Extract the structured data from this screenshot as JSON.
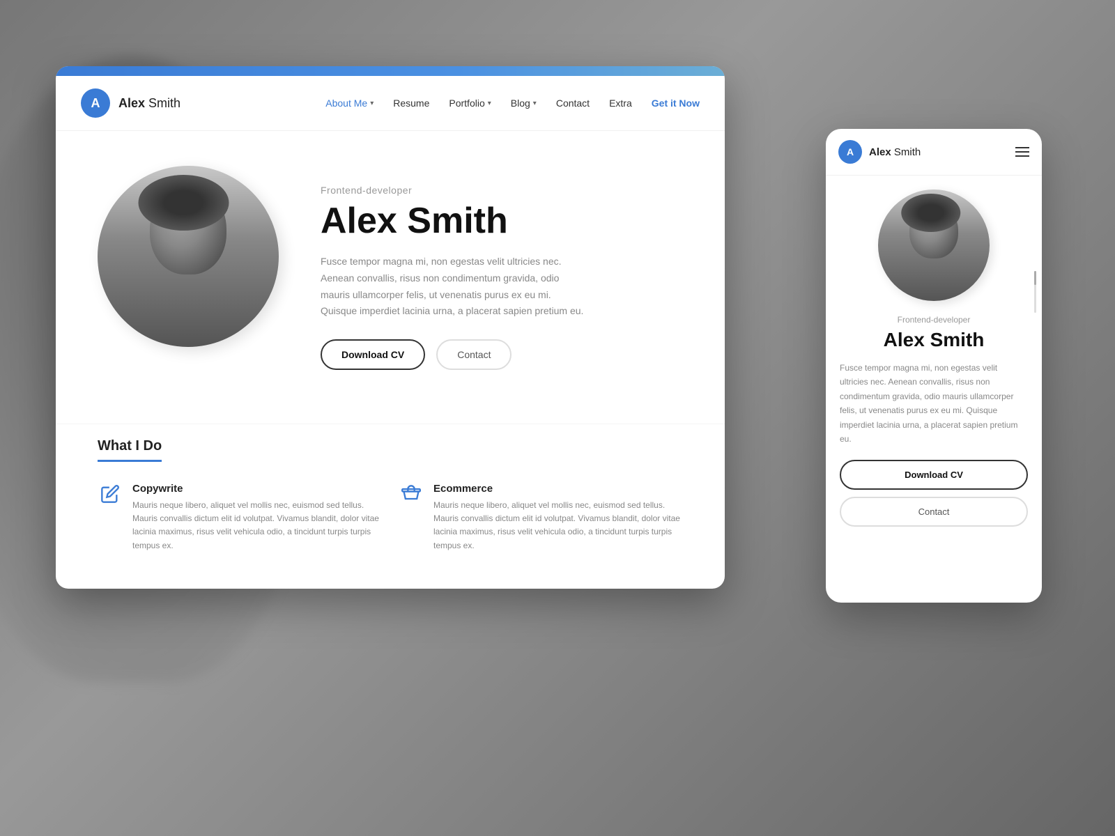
{
  "background": {
    "color": "#888"
  },
  "desktop": {
    "nav": {
      "logo_letter": "A",
      "logo_name_bold": "Alex",
      "logo_name_regular": " Smith",
      "links": [
        {
          "label": "About Me",
          "active": true,
          "has_chevron": true
        },
        {
          "label": "Resume",
          "active": false,
          "has_chevron": false
        },
        {
          "label": "Portfolio",
          "active": false,
          "has_chevron": true
        },
        {
          "label": "Blog",
          "active": false,
          "has_chevron": true
        },
        {
          "label": "Contact",
          "active": false,
          "has_chevron": false
        },
        {
          "label": "Extra",
          "active": false,
          "has_chevron": false
        },
        {
          "label": "Get it Now",
          "active": false,
          "has_chevron": false
        }
      ]
    },
    "hero": {
      "subtitle": "Frontend-developer",
      "name": "Alex Smith",
      "description": "Fusce tempor magna mi, non egestas velit ultricies nec. Aenean convallis, risus non condimentum gravida, odio mauris ullamcorper felis, ut venenatis purus ex eu mi. Quisque imperdiet lacinia urna, a placerat sapien pretium eu.",
      "btn_primary": "Download CV",
      "btn_secondary": "Contact"
    },
    "what_i_do": {
      "section_title": "What I Do",
      "services": [
        {
          "icon": "pencil",
          "title": "Copywrite",
          "description": "Mauris neque libero, aliquet vel mollis nec, euismod sed tellus. Mauris convallis dictum elit id volutpat. Vivamus blandit, dolor vitae lacinia maximus, risus velit vehicula odio, a tincidunt turpis turpis tempus ex."
        },
        {
          "icon": "store",
          "title": "Ecommerce",
          "description": "Mauris neque libero, aliquet vel mollis nec, euismod sed tellus. Mauris convallis dictum elit id volutpat. Vivamus blandit, dolor vitae lacinia maximus, risus velit vehicula odio, a tincidunt turpis turpis tempus ex."
        }
      ]
    }
  },
  "mobile": {
    "nav": {
      "logo_letter": "A",
      "logo_name_bold": "Alex",
      "logo_name_regular": " Smith"
    },
    "hero": {
      "subtitle": "Frontend-developer",
      "name": "Alex Smith",
      "description": "Fusce tempor magna mi, non egestas velit ultricies nec. Aenean convallis, risus non condimentum gravida, odio mauris ullamcorper felis, ut venenatis purus ex eu mi. Quisque imperdiet lacinia urna, a placerat sapien pretium eu.",
      "btn_primary": "Download CV",
      "btn_secondary": "Contact"
    }
  },
  "colors": {
    "accent": "#3a7bd5",
    "text_primary": "#111",
    "text_secondary": "#888",
    "border": "#ddd"
  }
}
